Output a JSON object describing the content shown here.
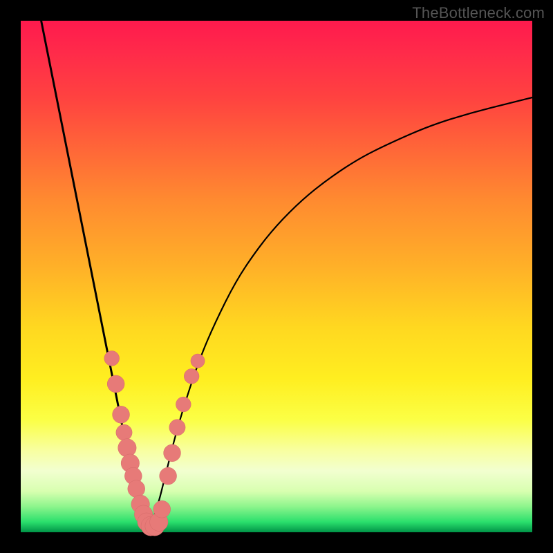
{
  "watermark": "TheBottleneck.com",
  "colors": {
    "curve": "#000000",
    "marker_fill": "#e77a78",
    "marker_stroke": "#d46a68"
  },
  "chart_data": {
    "type": "line",
    "title": "",
    "xlabel": "",
    "ylabel": "",
    "xlim": [
      0,
      100
    ],
    "ylim": [
      0,
      100
    ],
    "series": [
      {
        "name": "left-curve",
        "x": [
          4,
          6,
          8,
          10,
          12,
          14,
          15,
          16,
          17,
          18,
          19,
          20,
          21,
          22,
          23,
          23.8,
          24.5,
          25
        ],
        "y": [
          100,
          90,
          80,
          70,
          60,
          50,
          45,
          40,
          35,
          30,
          25,
          20,
          16,
          12,
          8,
          5,
          2,
          0
        ]
      },
      {
        "name": "right-curve",
        "x": [
          25,
          26,
          27,
          28,
          29,
          30,
          32,
          35,
          38,
          42,
          46,
          50,
          55,
          60,
          66,
          72,
          80,
          88,
          96,
          100
        ],
        "y": [
          0,
          3,
          6,
          10,
          14,
          18,
          25,
          34,
          41,
          49,
          55,
          60,
          65,
          69,
          73,
          76,
          79.5,
          82,
          84,
          85
        ]
      }
    ],
    "markers": [
      {
        "x": 17.8,
        "y": 34,
        "r": 1.4
      },
      {
        "x": 18.6,
        "y": 29,
        "r": 1.6
      },
      {
        "x": 19.6,
        "y": 23,
        "r": 1.6
      },
      {
        "x": 20.2,
        "y": 19.5,
        "r": 1.5
      },
      {
        "x": 20.8,
        "y": 16.5,
        "r": 1.7
      },
      {
        "x": 21.4,
        "y": 13.5,
        "r": 1.7
      },
      {
        "x": 22.0,
        "y": 11,
        "r": 1.6
      },
      {
        "x": 22.6,
        "y": 8.5,
        "r": 1.6
      },
      {
        "x": 23.4,
        "y": 5.5,
        "r": 1.7
      },
      {
        "x": 24.0,
        "y": 3.5,
        "r": 1.7
      },
      {
        "x": 24.6,
        "y": 2,
        "r": 1.7
      },
      {
        "x": 25.4,
        "y": 1.2,
        "r": 1.8
      },
      {
        "x": 26.2,
        "y": 1.2,
        "r": 1.8
      },
      {
        "x": 27.0,
        "y": 2,
        "r": 1.7
      },
      {
        "x": 27.6,
        "y": 4.5,
        "r": 1.6
      },
      {
        "x": 28.8,
        "y": 11,
        "r": 1.6
      },
      {
        "x": 29.6,
        "y": 15.5,
        "r": 1.6
      },
      {
        "x": 30.6,
        "y": 20.5,
        "r": 1.5
      },
      {
        "x": 31.8,
        "y": 25,
        "r": 1.4
      },
      {
        "x": 33.4,
        "y": 30.5,
        "r": 1.4
      },
      {
        "x": 34.6,
        "y": 33.5,
        "r": 1.3
      }
    ]
  }
}
